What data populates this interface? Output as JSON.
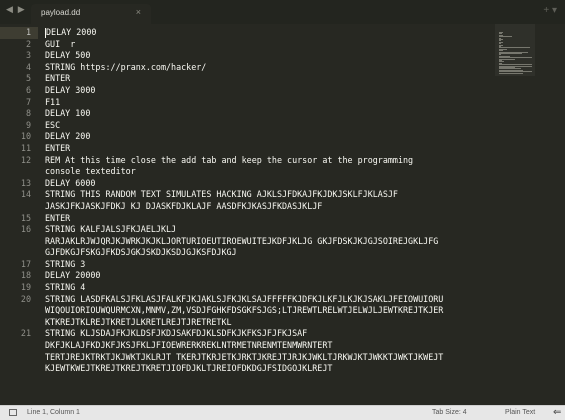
{
  "tabbar": {
    "nav_arrows": "◀ ▶",
    "tab_label": "payload.dd",
    "tab_close": "×",
    "controls": "+ ▾"
  },
  "editor": {
    "current_line": 1,
    "lines": [
      {
        "n": "1",
        "text": "DELAY 2000"
      },
      {
        "n": "2",
        "text": "GUI  r"
      },
      {
        "n": "3",
        "text": "DELAY 500"
      },
      {
        "n": "4",
        "text": "STRING https://pranx.com/hacker/"
      },
      {
        "n": "5",
        "text": "ENTER"
      },
      {
        "n": "6",
        "text": "DELAY 3000"
      },
      {
        "n": "7",
        "text": "F11"
      },
      {
        "n": "8",
        "text": "DELAY 100"
      },
      {
        "n": "9",
        "text": "ESC"
      },
      {
        "n": "10",
        "text": "DELAY 200"
      },
      {
        "n": "11",
        "text": "ENTER"
      },
      {
        "n": "12",
        "text": "REM At this time close the add tab and keep the cursor at the programming"
      },
      {
        "n": "",
        "text": "console texteditor"
      },
      {
        "n": "13",
        "text": "DELAY 6000"
      },
      {
        "n": "14",
        "text": "STRING THIS RANDOM TEXT SIMULATES HACKING AJKLSJFDKAJFKJDKJSKLFJKLASJF"
      },
      {
        "n": "",
        "text": "JASKJFKJASKJFDKJ KJ DJASKFDJKLAJF AASDFKJKASJFKDASJKLJF"
      },
      {
        "n": "15",
        "text": "ENTER"
      },
      {
        "n": "16",
        "text": "STRING KALFJALSJFKJAELJKLJ"
      },
      {
        "n": "",
        "text": "RARJAKLRJWJQRJKJWRKJKJKLJORTURIOEUTIROEWUITEJKDFJKLJG GKJFDSKJKJGJSOIREJGKLJFG"
      },
      {
        "n": "",
        "text": "GJFDKGJFSKGJFKDSJGKJSKDJKSDJGJKSFDJKGJ"
      },
      {
        "n": "17",
        "text": "STRING 3"
      },
      {
        "n": "18",
        "text": "DELAY 20000"
      },
      {
        "n": "19",
        "text": "STRING 4"
      },
      {
        "n": "20",
        "text": "STRING LASDFKALSJFKLASJFALKFJKJAKLSJFKJKLSAJFFFFFKJDFKJLKFJLKJKJSAKLJFEIOWUIORU"
      },
      {
        "n": "",
        "text": "WIQOUIORIOUWQURMCXN,MNMV,ZM,VSDJFGHKFDSGKFSJGS;LTJREWTLRELWTJELWJLJEWTKREJTKJER"
      },
      {
        "n": "",
        "text": "KTKREJTKLREJTKRETJLKRETLREJTJRETRETKL"
      },
      {
        "n": "21",
        "text": "STRING KLJSDAJFKJKLDSFJKDJSAKFDJKLSDFKJKFKSJFJFKJSAF"
      },
      {
        "n": "",
        "text": "DKFJKLAJFKDJKFJKSJFKLJFIOEWRERKREKLNTRMETNRENMTENMWRNTERT"
      },
      {
        "n": "",
        "text": "TERTJREJKTRKTJKJWKTJKLRJT TKERJTKRJETKJRKTJKREJTJRJKJWKLTJRKWJKTJWKKTJWKTJKWEJT"
      },
      {
        "n": "",
        "text": "KJEWTKWEJTKREJTKREJTKRETJIOFDJKLTJREIOFDKDGJFSIDGOJKLREJT"
      }
    ]
  },
  "status": {
    "cursor": "Line 1, Column 1",
    "tab_size": "Tab Size: 4",
    "syntax": "Plain Text",
    "back_arrow": "⇐"
  },
  "colors": {
    "editor_bg": "#272822",
    "tabbar_bg": "#23251f",
    "text": "#f8f8f2",
    "line_number": "#90908a",
    "status_bg": "#e7e7e7"
  }
}
